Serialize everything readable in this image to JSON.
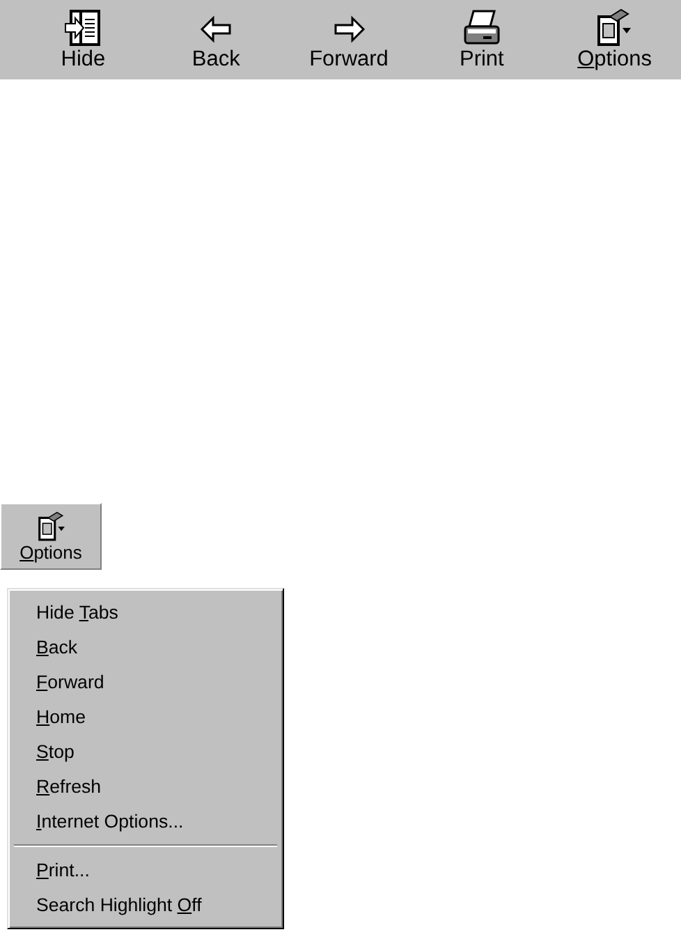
{
  "toolbar": [
    {
      "label": {
        "pre": "Hide"
      }
    },
    {
      "label": {
        "pre": "Back"
      }
    },
    {
      "label": {
        "pre": "Forward"
      }
    },
    {
      "label": {
        "pre": "Print"
      }
    },
    {
      "label": {
        "key": "O",
        "post": "ptions"
      }
    }
  ],
  "options_button": {
    "label": {
      "key": "O",
      "post": "ptions"
    },
    "pressed": false
  },
  "menu": [
    {
      "kind": "item",
      "label": {
        "pre": "Hide ",
        "key": "T",
        "post": "abs"
      }
    },
    {
      "kind": "item",
      "label": {
        "key": "B",
        "post": "ack"
      }
    },
    {
      "kind": "item",
      "label": {
        "key": "F",
        "post": "orward"
      }
    },
    {
      "kind": "item",
      "label": {
        "key": "H",
        "post": "ome"
      }
    },
    {
      "kind": "item",
      "label": {
        "key": "S",
        "post": "top"
      }
    },
    {
      "kind": "item",
      "label": {
        "key": "R",
        "post": "efresh"
      }
    },
    {
      "kind": "item",
      "label": {
        "key": "I",
        "post": "nternet Options..."
      }
    },
    {
      "kind": "separator"
    },
    {
      "kind": "item",
      "label": {
        "key": "P",
        "post": "rint..."
      }
    },
    {
      "kind": "item",
      "label": {
        "pre": "Search Highlight ",
        "key": "O",
        "post": "ff"
      }
    }
  ]
}
